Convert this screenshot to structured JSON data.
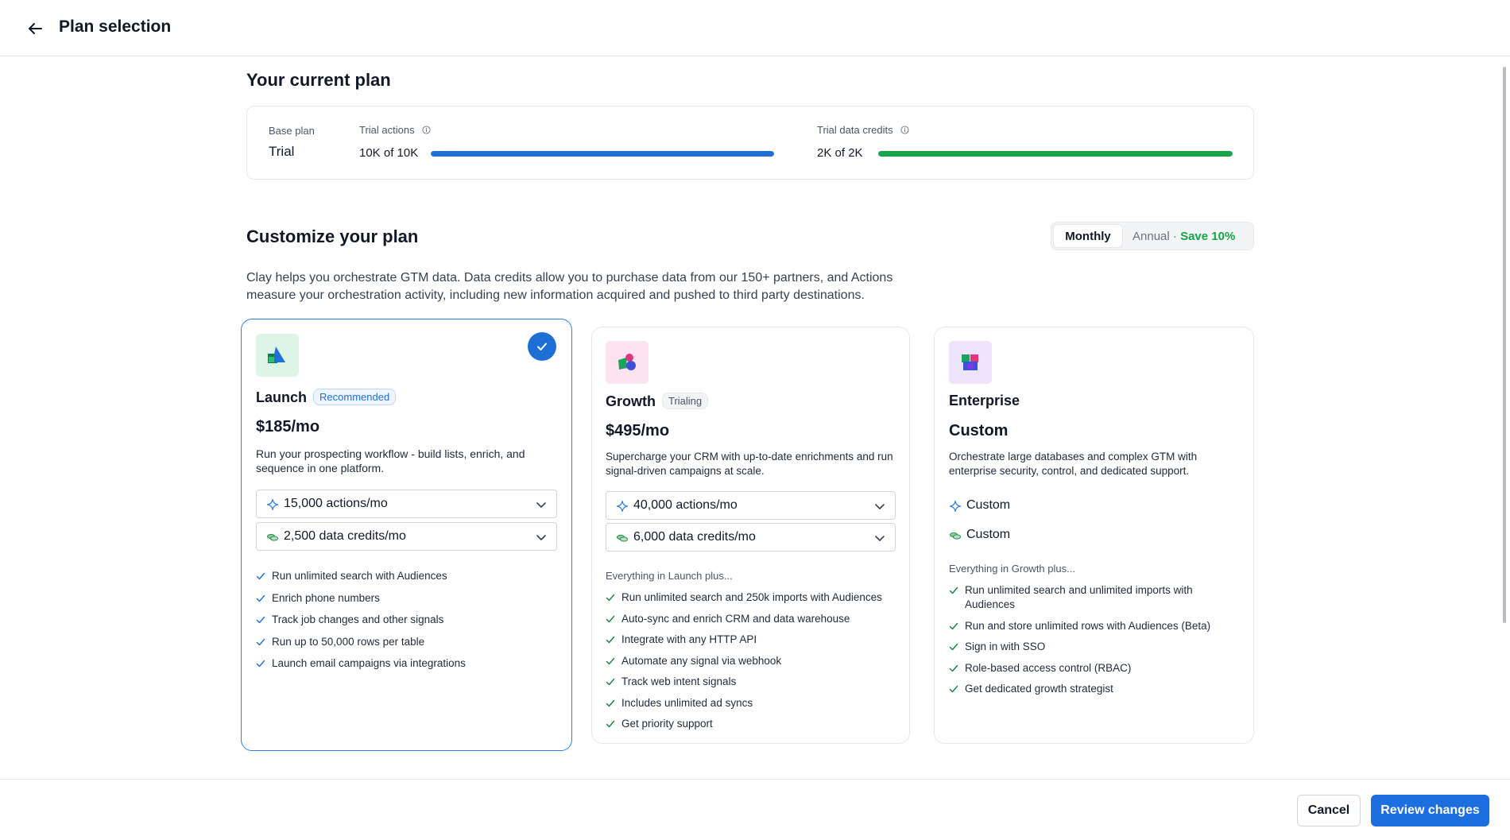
{
  "header": {
    "title": "Plan selection"
  },
  "current_plan": {
    "heading": "Your current plan",
    "base_plan_label": "Base plan",
    "base_plan_value": "Trial",
    "actions": {
      "label": "Trial actions",
      "value": "10K of 10K",
      "progress": 1.0,
      "color": "#1f6fd6"
    },
    "credits": {
      "label": "Trial data credits",
      "value": "2K of 2K",
      "progress": 1.0,
      "color": "#16a34a"
    }
  },
  "customize": {
    "heading": "Customize your plan",
    "billing": {
      "monthly": "Monthly",
      "annual": "Annual",
      "separator": "·",
      "save": "Save 10%",
      "selected": "Monthly"
    },
    "description": "Clay helps you orchestrate GTM data. Data credits allow you to purchase data from our 150+ partners, and Actions measure your orchestration activity, including new information acquired and pushed to third party destinations."
  },
  "plans": [
    {
      "name": "Launch",
      "badge": "Recommended",
      "selected": true,
      "price": "$185/mo",
      "description": "Run your prospecting workflow - build lists, enrich, and sequence in one platform.",
      "actions_select": "15,000 actions/mo",
      "credits_select": "2,500 data credits/mo",
      "features": [
        "Run unlimited search with Audiences",
        "Enrich phone numbers",
        "Track job changes and other signals",
        "Run up to 50,000 rows per table",
        "Launch email campaigns via integrations"
      ]
    },
    {
      "name": "Growth",
      "badge": "Trialing",
      "selected": false,
      "price": "$495/mo",
      "description": "Supercharge your CRM with up-to-date enrichments and run signal-driven campaigns at scale.",
      "actions_select": "40,000 actions/mo",
      "credits_select": "6,000 data credits/mo",
      "plus_label": "Everything in Launch plus...",
      "features": [
        "Run unlimited search and 250k imports with Audiences",
        "Auto-sync and enrich CRM and data warehouse",
        "Integrate with any HTTP API",
        "Automate any signal via webhook",
        "Track web intent signals",
        "Includes unlimited ad syncs",
        "Get priority support"
      ]
    },
    {
      "name": "Enterprise",
      "selected": false,
      "price": "Custom",
      "description": "Orchestrate large databases and complex GTM with enterprise security, control, and dedicated support.",
      "actions_value": "Custom",
      "credits_value": "Custom",
      "plus_label": "Everything in Growth plus...",
      "features": [
        "Run unlimited search and unlimited imports with Audiences",
        "Run and store unlimited rows with Audiences (Beta)",
        "Sign in with SSO",
        "Role-based access control (RBAC)",
        "Get dedicated growth strategist"
      ]
    }
  ],
  "footer": {
    "cancel": "Cancel",
    "review": "Review changes"
  },
  "colors": {
    "accent": "#1d6fe0",
    "selected_border": "#2f7fd8",
    "success": "#16a34a"
  },
  "icons": {
    "back": "arrow-left-icon",
    "info": "info-icon",
    "check": "check-icon",
    "chevron": "chevron-down-icon",
    "sparkle": "sparkle-icon",
    "coins": "coins-icon"
  }
}
